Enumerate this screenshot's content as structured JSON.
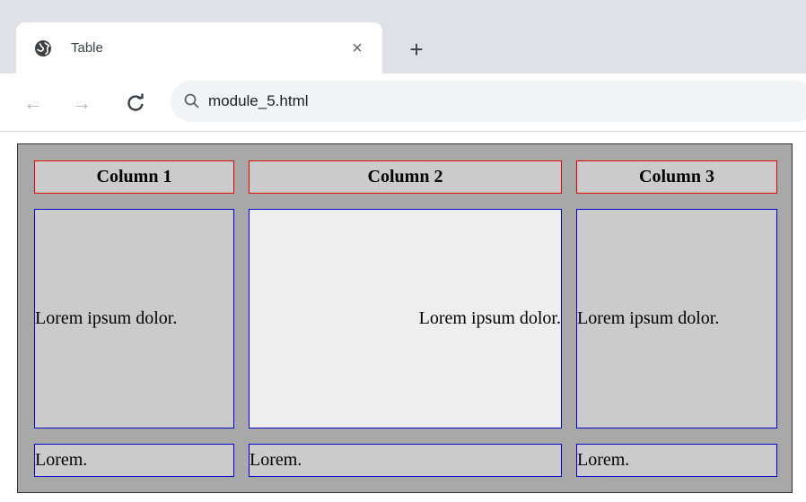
{
  "browser": {
    "tab": {
      "title": "Table",
      "close_glyph": "×",
      "favicon": "globe-icon"
    },
    "new_tab_glyph": "+",
    "toolbar": {
      "back_glyph": "←",
      "forward_glyph": "→",
      "reload_glyph": "C",
      "url": "module_5.html",
      "search_icon": "search-icon"
    },
    "colors": {
      "tabstrip": "#dee1e6",
      "omnibox": "#f1f3f4"
    }
  },
  "page": {
    "table": {
      "headers": [
        "Column 1",
        "Column 2",
        "Column 3"
      ],
      "rows": [
        [
          "Lorem ipsum dolor.",
          "Lorem ipsum dolor.",
          "Lorem ipsum dolor."
        ],
        [
          "Lorem.",
          "Lorem.",
          "Lorem."
        ]
      ],
      "colors": {
        "table_bg": "#a8a8a8",
        "cell_bg": "#cbcbcb",
        "highlight_cell_bg": "#efeeee",
        "header_border": "#e00000",
        "cell_border": "#0000cc"
      }
    }
  }
}
